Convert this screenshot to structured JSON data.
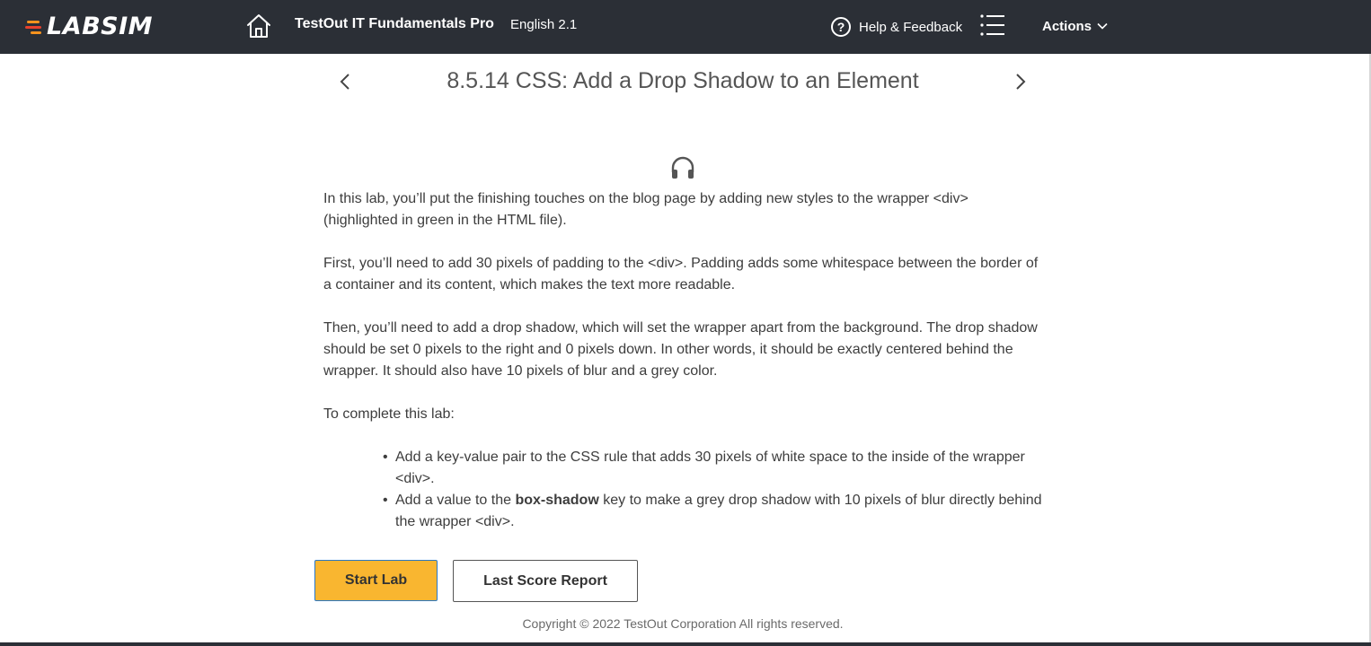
{
  "header": {
    "logo_text": "LABSIM",
    "home_icon": "home-icon",
    "course_title": "TestOut IT Fundamentals Pro",
    "course_language": "English 2.1",
    "help_icon": "question-circle-icon",
    "help_symbol": "?",
    "help_label": "Help & Feedback",
    "list_icon": "list-icon",
    "actions_label": "Actions",
    "actions_icon": "chevron-down-icon"
  },
  "lesson": {
    "title": "8.5.14 CSS: Add a Drop Shadow to an Element",
    "prev_icon": "chevron-left-icon",
    "next_icon": "chevron-right-icon",
    "audio_icon": "headphones-icon",
    "paragraphs": [
      "In this lab, you’ll put the finishing touches on the blog page by adding new styles to the wrapper <div> (highlighted in green in the HTML file).",
      "First, you’ll need to add 30 pixels of padding to the <div>. Padding adds some whitespace between the border of a container and its content, which makes the text more readable.",
      "Then, you’ll need to add a drop shadow, which will set the wrapper apart from the background. The drop shadow should be set 0 pixels to the right and 0 pixels down. In other words, it should be exactly centered behind the wrapper. It should also have 10 pixels of blur and a grey color.",
      "To complete this lab:"
    ],
    "bullet_1": "Add a key-value pair to the CSS rule that adds 30 pixels of white space to the inside of the wrapper <div>.",
    "bullet_2": {
      "before": "Add a value to the ",
      "bold": "box-shadow",
      "after": " key to make a grey drop shadow with 10 pixels of blur directly behind the wrapper <div>."
    }
  },
  "buttons": {
    "start_lab": "Start Lab",
    "last_score_report": "Last Score Report"
  },
  "footer": {
    "copyright": "Copyright © 2022 TestOut Corporation  All rights reserved."
  },
  "colors": {
    "topbar": "#2b2f36",
    "start_button": "#f9b630",
    "logo_accent_orange": "#f7931e",
    "logo_accent_red": "#e8412c"
  }
}
